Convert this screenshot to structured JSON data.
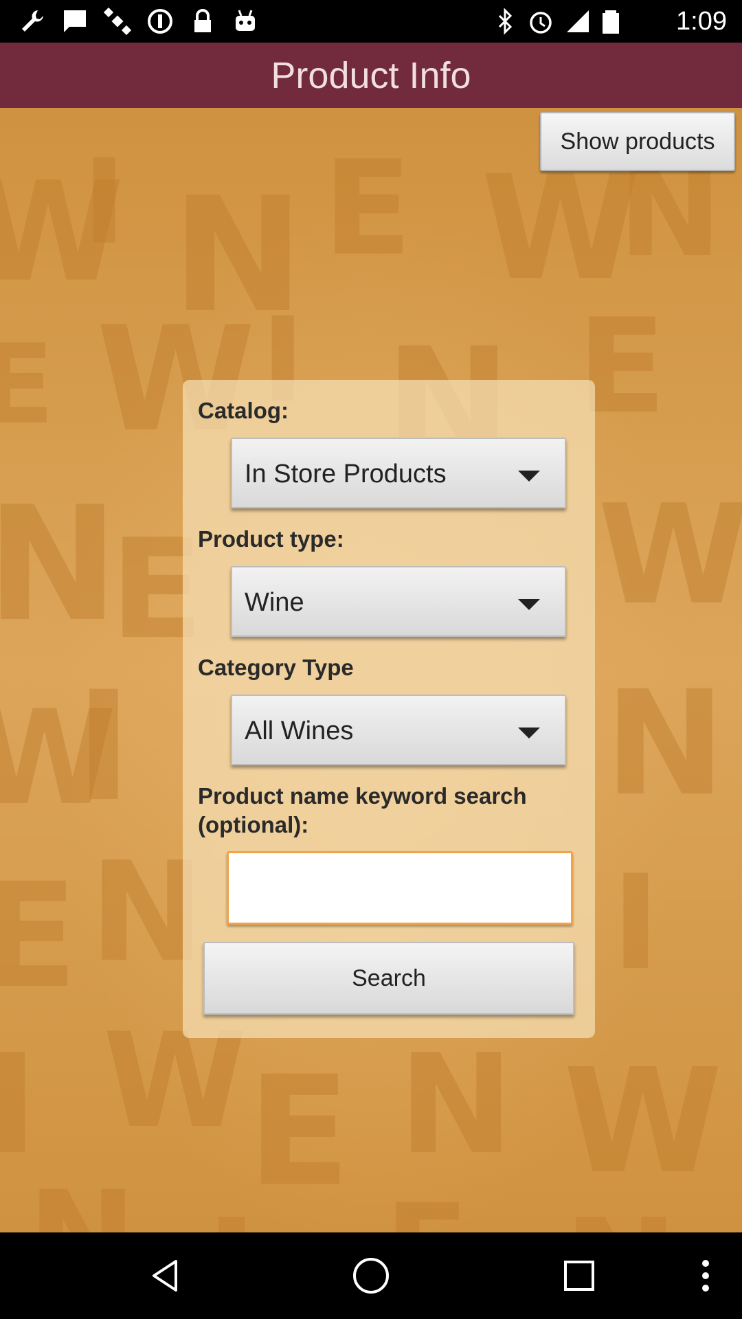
{
  "status_bar": {
    "time": "1:09",
    "icons": [
      "wrench-icon",
      "chat-icon",
      "satellite-icon",
      "info-circle-icon",
      "lock-icon",
      "android-icon",
      "bluetooth-icon",
      "alarm-icon",
      "signal-icon",
      "battery-icon"
    ]
  },
  "title_bar": {
    "title": "Product Info"
  },
  "toolbar": {
    "show_products_label": "Show products"
  },
  "form": {
    "catalog_label": "Catalog:",
    "catalog_value": "In Store Products",
    "product_type_label": "Product type:",
    "product_type_value": "Wine",
    "category_type_label": "Category Type",
    "category_type_value": "All Wines",
    "keyword_label_line1": "Product name keyword search",
    "keyword_label_line2": "(optional):",
    "keyword_value": "",
    "search_label": "Search"
  },
  "background": {
    "letters": [
      "W",
      "I",
      "N",
      "E"
    ]
  },
  "colors": {
    "title_bar": "#722a3d",
    "background": "#d89d4b",
    "input_border": "#f2a24a"
  },
  "nav_bar": {
    "icons": [
      "back-icon",
      "home-icon",
      "recents-icon",
      "menu-icon"
    ]
  }
}
